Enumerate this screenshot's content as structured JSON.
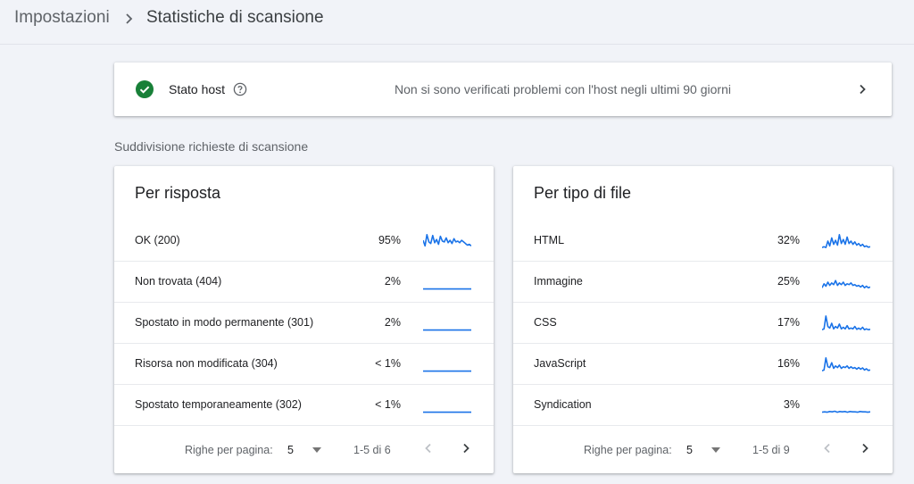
{
  "breadcrumb": {
    "parent": "Impostazioni",
    "current": "Statistiche di scansione"
  },
  "host": {
    "title": "Stato host",
    "status_text": "Non si sono verificati problemi con l'host negli ultimi 90 giorni",
    "status_color": "#188038"
  },
  "section_title": "Suddivisione richieste di scansione",
  "colors": {
    "sparkline": "#1a73e8",
    "ok_check": "#188038"
  },
  "tables": {
    "response": {
      "title": "Per risposta",
      "rows": [
        {
          "label": "OK (200)",
          "percent": "95%",
          "trend": [
            0.55,
            0.2,
            0.9,
            0.45,
            0.35,
            0.85,
            0.4,
            0.6,
            0.3,
            0.8,
            0.5,
            0.45,
            0.7,
            0.4,
            0.55,
            0.35,
            0.65,
            0.45,
            0.5,
            0.4,
            0.55,
            0.45,
            0.35,
            0.25,
            0.3,
            0.2
          ]
        },
        {
          "label": "Non trovata (404)",
          "percent": "2%",
          "trend": [
            0.08,
            0.08,
            0.08,
            0.08,
            0.08,
            0.08,
            0.08,
            0.08,
            0.08,
            0.08,
            0.08,
            0.08,
            0.08,
            0.08
          ]
        },
        {
          "label": "Spostato in modo permanente (301)",
          "percent": "2%",
          "trend": [
            0.08,
            0.08,
            0.08,
            0.08,
            0.08,
            0.08,
            0.08,
            0.08,
            0.08,
            0.08,
            0.08,
            0.08,
            0.08,
            0.08
          ]
        },
        {
          "label": "Risorsa non modificata (304)",
          "percent": "< 1%",
          "trend": [
            0.08,
            0.08,
            0.08,
            0.08,
            0.08,
            0.08,
            0.08,
            0.08,
            0.08,
            0.08,
            0.08,
            0.08,
            0.08,
            0.08
          ]
        },
        {
          "label": "Spostato temporaneamente (302)",
          "percent": "< 1%",
          "trend": [
            0.08,
            0.08,
            0.08,
            0.08,
            0.08,
            0.08,
            0.08,
            0.08,
            0.08,
            0.08,
            0.08,
            0.08,
            0.08,
            0.08
          ]
        }
      ],
      "pager": {
        "label": "Righe per pagina:",
        "value": "5",
        "range": "1-5 di 6"
      }
    },
    "filetype": {
      "title": "Per tipo di file",
      "rows": [
        {
          "label": "HTML",
          "percent": "32%",
          "trend": [
            0.1,
            0.15,
            0.1,
            0.5,
            0.2,
            0.7,
            0.3,
            0.55,
            0.25,
            0.9,
            0.35,
            0.6,
            0.3,
            0.75,
            0.35,
            0.5,
            0.3,
            0.45,
            0.25,
            0.35,
            0.2,
            0.3,
            0.15,
            0.2,
            0.12,
            0.15
          ]
        },
        {
          "label": "Immagine",
          "percent": "25%",
          "trend": [
            0.15,
            0.4,
            0.25,
            0.5,
            0.3,
            0.45,
            0.35,
            0.6,
            0.3,
            0.45,
            0.35,
            0.5,
            0.3,
            0.4,
            0.35,
            0.45,
            0.3,
            0.35,
            0.25,
            0.3,
            0.2,
            0.3,
            0.15,
            0.25,
            0.15,
            0.2
          ]
        },
        {
          "label": "CSS",
          "percent": "17%",
          "trend": [
            0.1,
            0.15,
            0.95,
            0.3,
            0.2,
            0.5,
            0.15,
            0.3,
            0.2,
            0.45,
            0.15,
            0.25,
            0.15,
            0.35,
            0.15,
            0.2,
            0.15,
            0.3,
            0.12,
            0.2,
            0.12,
            0.25,
            0.1,
            0.15,
            0.1,
            0.12
          ]
        },
        {
          "label": "JavaScript",
          "percent": "16%",
          "trend": [
            0.1,
            0.15,
            0.9,
            0.35,
            0.3,
            0.6,
            0.25,
            0.4,
            0.3,
            0.45,
            0.25,
            0.35,
            0.3,
            0.4,
            0.25,
            0.35,
            0.25,
            0.3,
            0.2,
            0.3,
            0.2,
            0.28,
            0.15,
            0.22,
            0.12,
            0.15
          ]
        },
        {
          "label": "Syndication",
          "percent": "3%",
          "trend": [
            0.08,
            0.1,
            0.08,
            0.12,
            0.1,
            0.14,
            0.08,
            0.12,
            0.1,
            0.12,
            0.08,
            0.12,
            0.1,
            0.1,
            0.08,
            0.12,
            0.1,
            0.1,
            0.08,
            0.1
          ]
        }
      ],
      "pager": {
        "label": "Righe per pagina:",
        "value": "5",
        "range": "1-5 di 9"
      }
    }
  }
}
